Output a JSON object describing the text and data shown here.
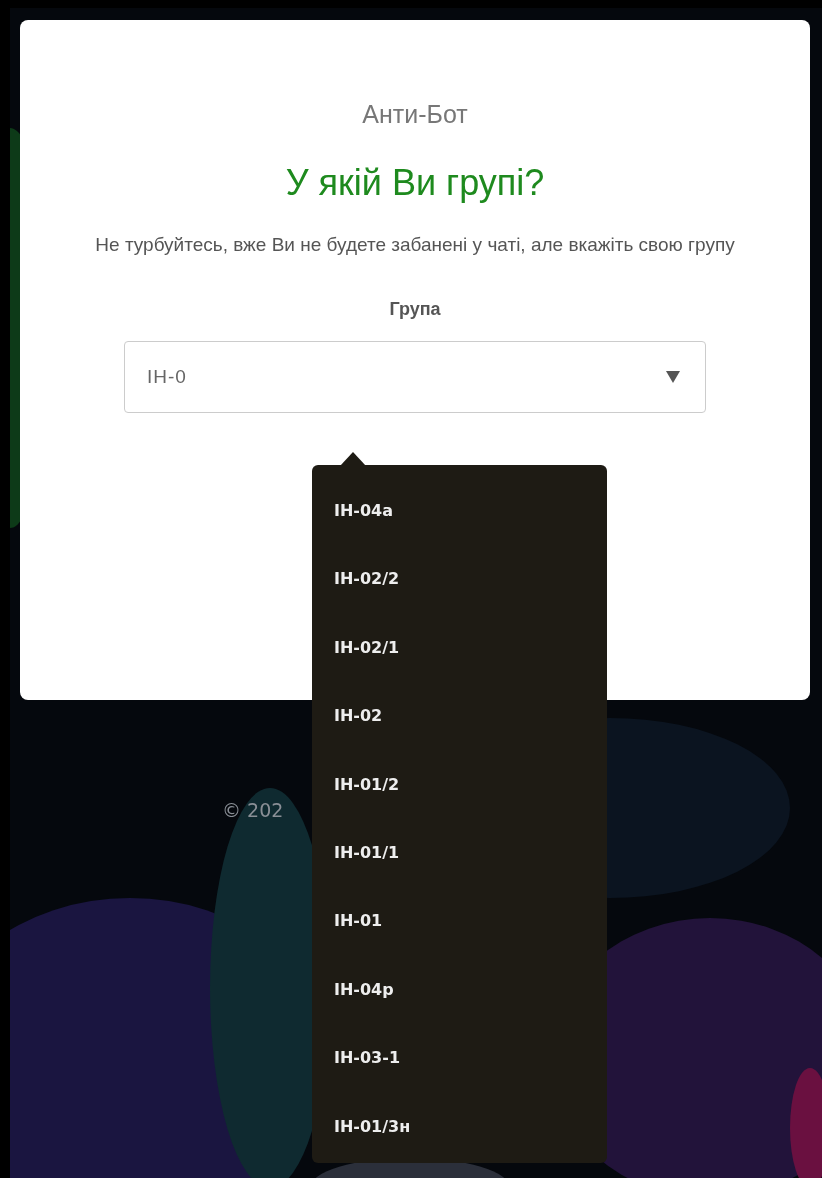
{
  "card": {
    "overline": "Анти-Бот",
    "title": "У якій Ви групі?",
    "description": "Не турбуйтесь, вже Ви не будете забанені у чаті, але вкажіть свою групу",
    "field": {
      "label": "Група",
      "value": "ІН-0"
    }
  },
  "dropdown": {
    "items": [
      {
        "label": "ІН-04а"
      },
      {
        "label": "ІН-02/2"
      },
      {
        "label": "ІН-02/1"
      },
      {
        "label": "ІН-02"
      },
      {
        "label": "ІН-01/2"
      },
      {
        "label": "ІН-01/1"
      },
      {
        "label": "ІН-01"
      },
      {
        "label": "ІН-04р"
      },
      {
        "label": "ІН-03-1"
      },
      {
        "label": "ІН-01/3н"
      }
    ]
  },
  "footer": {
    "text": "© 202"
  }
}
